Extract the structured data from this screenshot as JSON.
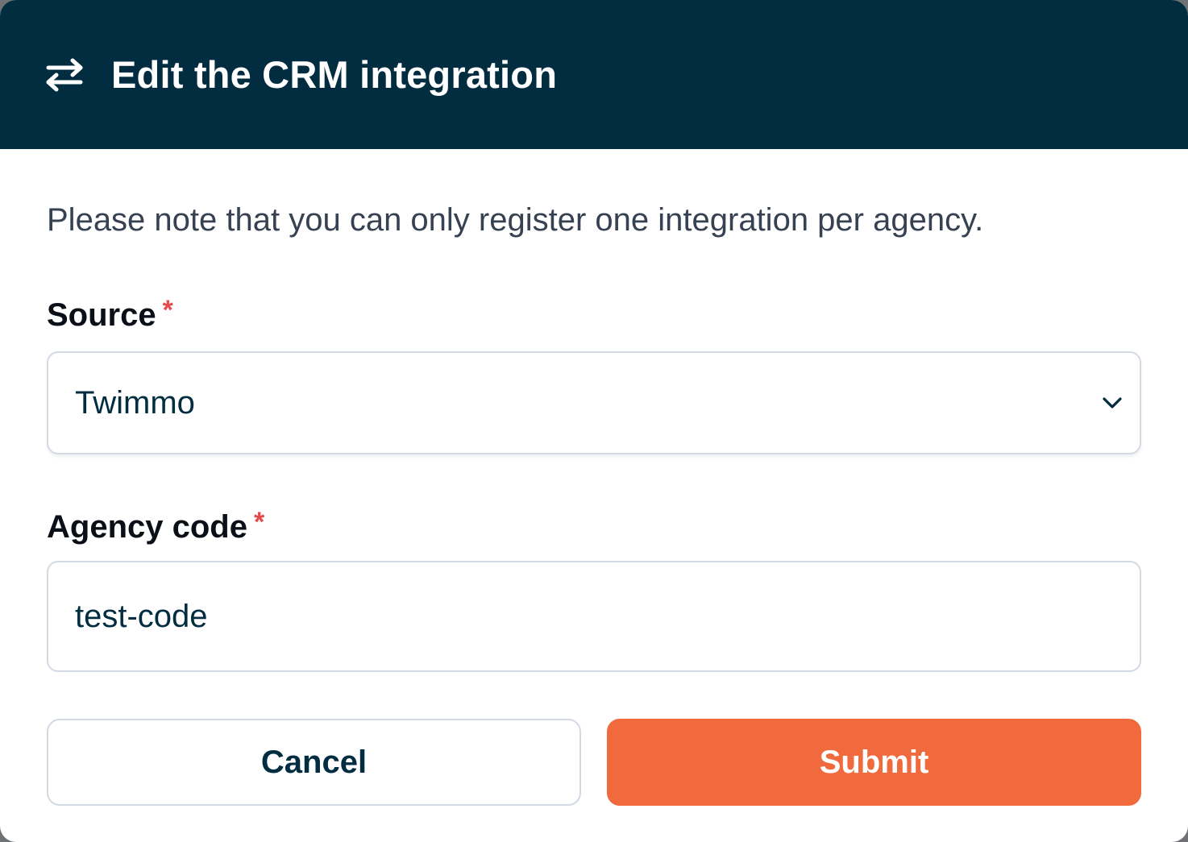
{
  "header": {
    "title": "Edit the CRM integration",
    "icon": "swap-arrows-icon"
  },
  "notice": "Please note that you can only register one integration per agency.",
  "fields": {
    "source": {
      "label": "Source",
      "required_mark": "*",
      "value": "Twimmo"
    },
    "agency_code": {
      "label": "Agency code",
      "required_mark": "*",
      "value": "test-code"
    }
  },
  "buttons": {
    "cancel": "Cancel",
    "submit": "Submit"
  },
  "colors": {
    "header_bg": "#022d41",
    "accent": "#f06a3e",
    "required": "#e5484d"
  }
}
